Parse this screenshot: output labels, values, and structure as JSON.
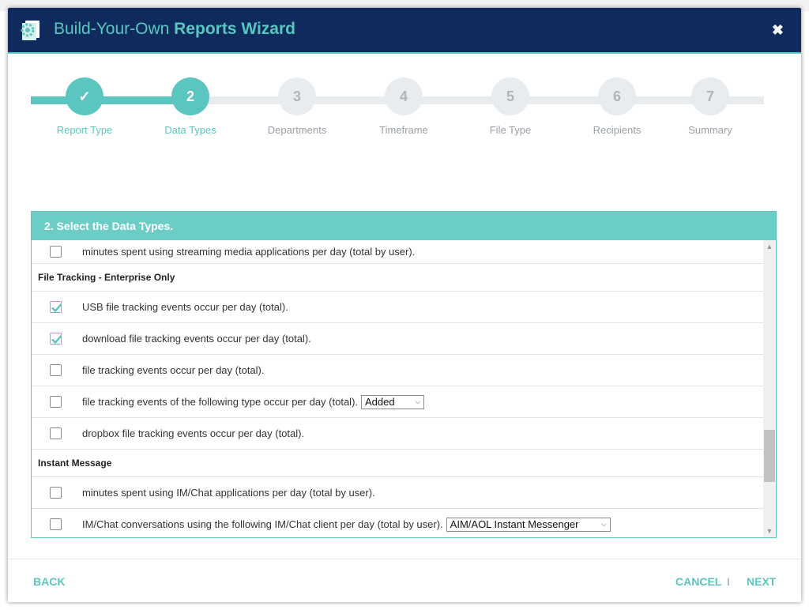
{
  "header": {
    "title_part1": "Build-Your-Own ",
    "title_part2": "Reports Wizard",
    "close_label": "✖"
  },
  "steps": [
    {
      "num": "✓",
      "label": "Report Type",
      "state": "done"
    },
    {
      "num": "2",
      "label": "Data Types",
      "state": "active"
    },
    {
      "num": "3",
      "label": "Departments",
      "state": "todo"
    },
    {
      "num": "4",
      "label": "Timeframe",
      "state": "todo"
    },
    {
      "num": "5",
      "label": "File Type",
      "state": "todo"
    },
    {
      "num": "6",
      "label": "Recipients",
      "state": "todo"
    },
    {
      "num": "7",
      "label": "Summary",
      "state": "todo"
    }
  ],
  "panel": {
    "title": "2. Select the Data Types.",
    "rows": {
      "streaming": {
        "text": "minutes spent using streaming media applications per day (total by user).",
        "checked": false
      },
      "file_section": "File Tracking - Enterprise Only",
      "usb": {
        "text": "USB file tracking events occur per day (total).",
        "checked": true
      },
      "download": {
        "text": "download file tracking events occur per day (total).",
        "checked": true
      },
      "file_events": {
        "text": "file tracking events occur per day (total).",
        "checked": false
      },
      "file_type": {
        "text": "file tracking events of the following type occur per day (total).",
        "checked": false,
        "select_value": "Added"
      },
      "dropbox": {
        "text": "dropbox file tracking events occur per day (total).",
        "checked": false
      },
      "im_section": "Instant Message",
      "im_minutes": {
        "text": "minutes spent using IM/Chat applications per day (total by user).",
        "checked": false
      },
      "im_client": {
        "text": "IM/Chat conversations using the following IM/Chat client per day (total by user).",
        "checked": false,
        "select_value": "AIM/AOL Instant Messenger"
      }
    }
  },
  "footer": {
    "back": "BACK",
    "cancel": "CANCEL",
    "separator": "I",
    "next": "NEXT"
  },
  "colors": {
    "accent": "#5bc6c0",
    "header_bg": "#0f2a5c"
  }
}
